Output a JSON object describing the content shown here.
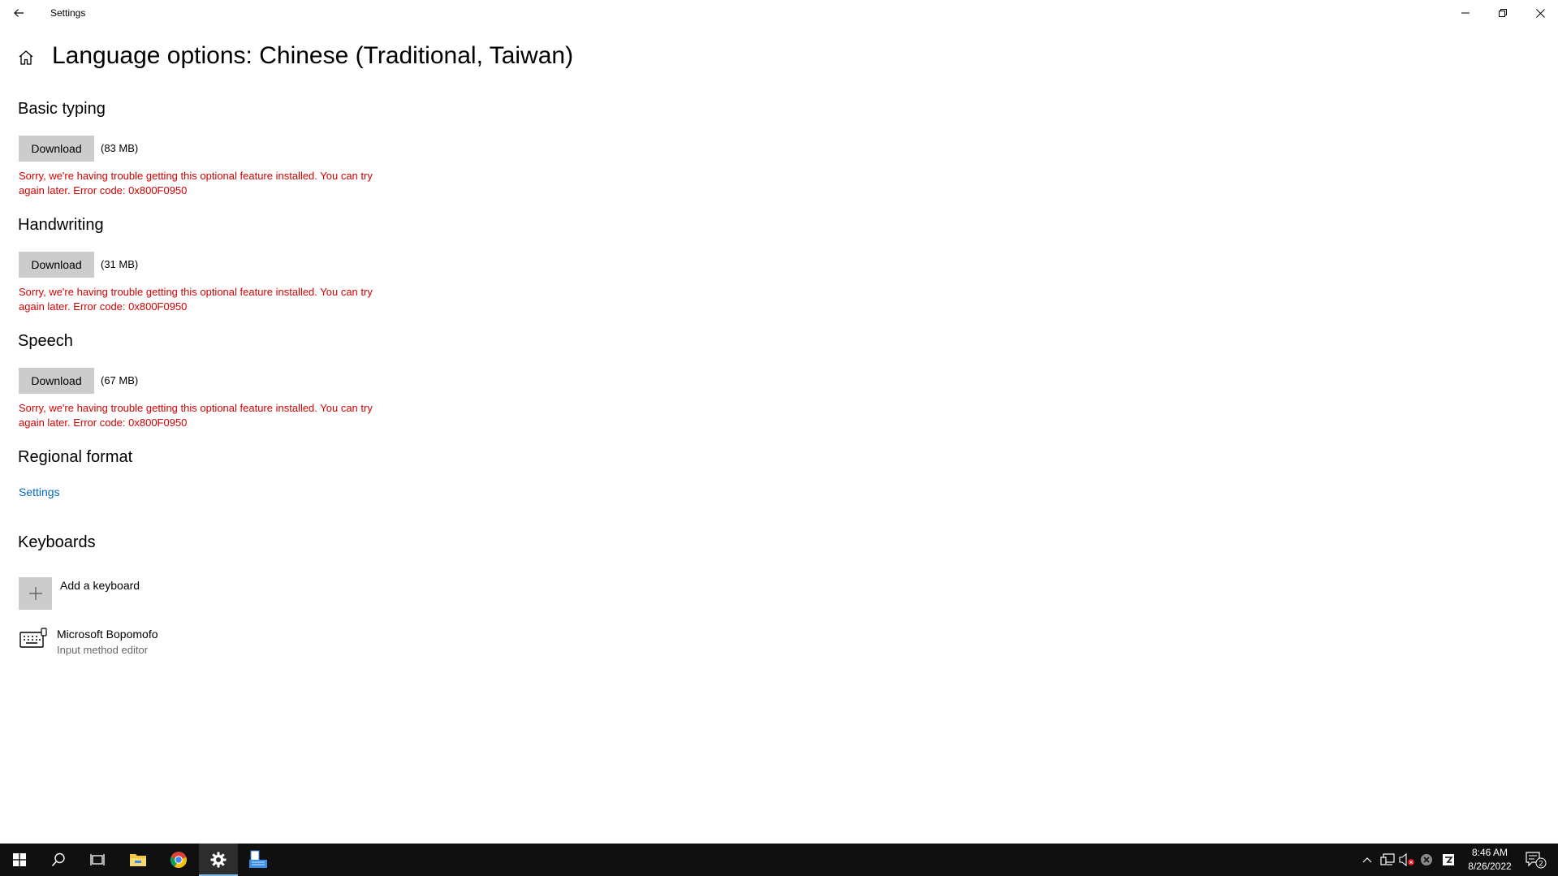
{
  "window": {
    "title": "Settings"
  },
  "page": {
    "title": "Language options: Chinese (Traditional, Taiwan)"
  },
  "sections": {
    "basic_typing": {
      "heading": "Basic typing",
      "button": "Download",
      "size": "(83 MB)",
      "error": "Sorry, we're having trouble getting this optional feature installed. You can try again later. Error code: 0x800F0950"
    },
    "handwriting": {
      "heading": "Handwriting",
      "button": "Download",
      "size": "(31 MB)",
      "error": "Sorry, we're having trouble getting this optional feature installed. You can try again later. Error code: 0x800F0950"
    },
    "speech": {
      "heading": "Speech",
      "button": "Download",
      "size": "(67 MB)",
      "error": "Sorry, we're having trouble getting this optional feature installed. You can try again later. Error code: 0x800F0950"
    },
    "regional_format": {
      "heading": "Regional format",
      "link": "Settings"
    },
    "keyboards": {
      "heading": "Keyboards",
      "add_label": "Add a keyboard",
      "items": [
        {
          "name": "Microsoft Bopomofo",
          "subtitle": "Input method editor"
        }
      ]
    }
  },
  "taskbar": {
    "apps": [
      "start-icon",
      "search-icon",
      "task-view-icon",
      "file-explorer-icon",
      "chrome-icon",
      "settings-icon",
      "language-app-icon"
    ],
    "active_app": "settings-icon",
    "clock": {
      "time": "8:46 AM",
      "date": "8/26/2022"
    },
    "notification_count": "2"
  },
  "colors": {
    "error": "#d40000",
    "link": "#0067c0",
    "button_bg": "#cccccc",
    "taskbar_bg": "#101010",
    "active_indicator": "#76b9ed"
  }
}
